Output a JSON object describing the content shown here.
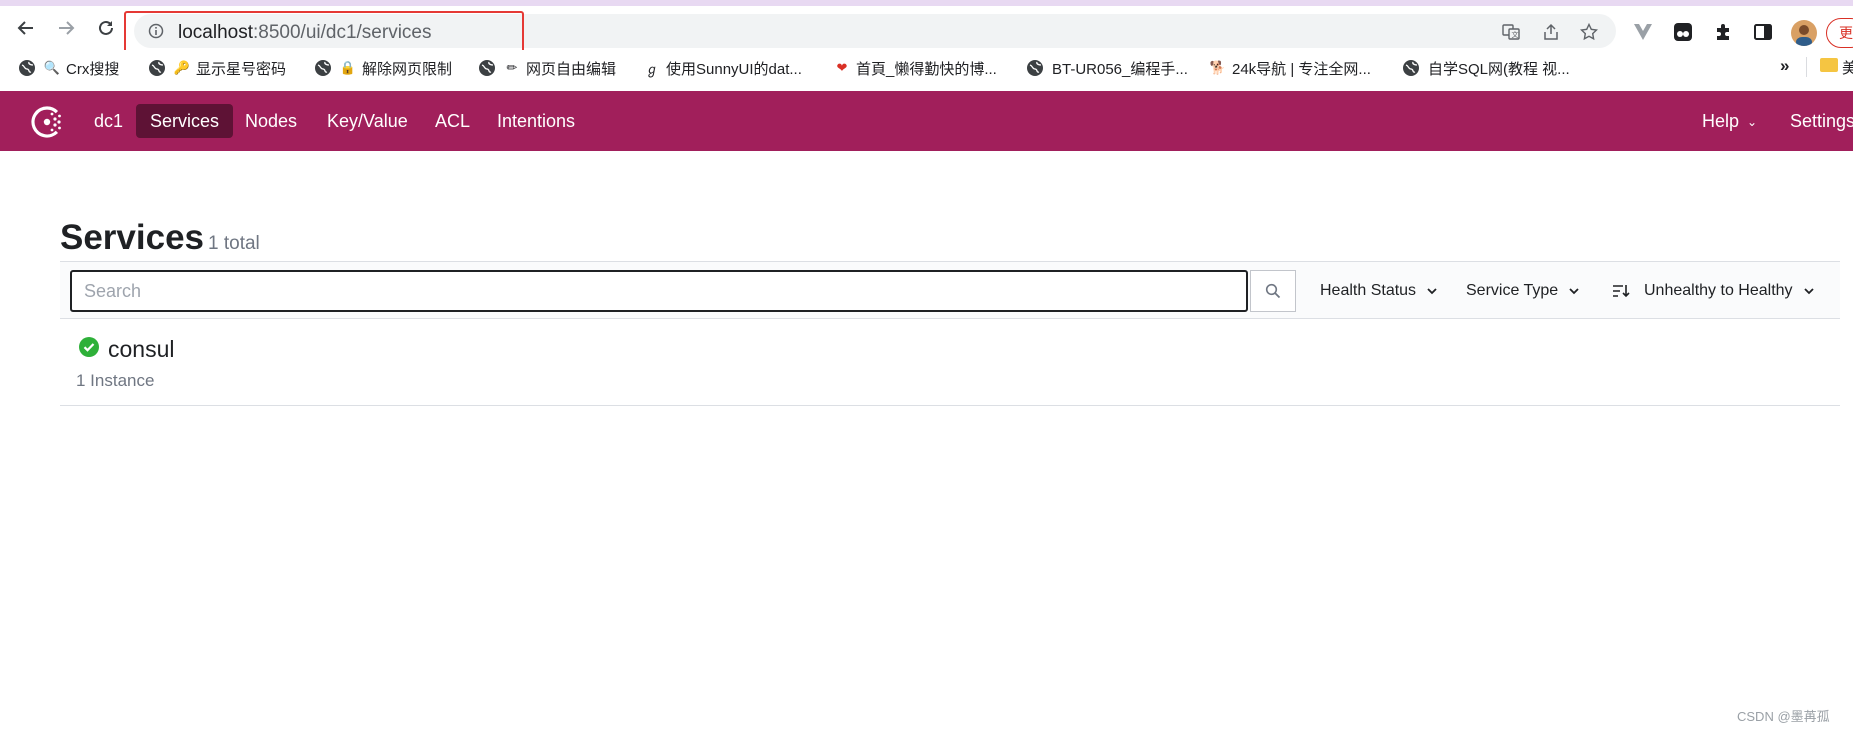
{
  "browser": {
    "url_host": "localhost",
    "url_rest": ":8500/ui/dc1/services",
    "bookmarks": [
      {
        "label": "Crx搜搜"
      },
      {
        "label": "显示星号密码"
      },
      {
        "label": "解除网页限制"
      },
      {
        "label": "网页自由编辑"
      },
      {
        "label": "使用SunnyUI的dat..."
      },
      {
        "label": "首頁_懒得勤快的博..."
      },
      {
        "label": "BT-UR056_编程手..."
      },
      {
        "label": "24k导航 | 专注全网..."
      },
      {
        "label": "自学SQL网(教程 视..."
      }
    ],
    "bookmarks_overflow": "»",
    "bookmark_cut": "美",
    "update_label": "更"
  },
  "app": {
    "datacenter": "dc1",
    "nav": [
      "Services",
      "Nodes",
      "Key/Value",
      "ACL",
      "Intentions"
    ],
    "help_label": "Help",
    "settings_label": "Settings"
  },
  "page": {
    "title": "Services",
    "count": "1 total",
    "search_placeholder": "Search",
    "filters": {
      "health_status": "Health Status",
      "service_type": "Service Type",
      "sort": "Unhealthy to Healthy"
    },
    "services": [
      {
        "name": "consul",
        "instances": "1 Instance",
        "status": "passing",
        "status_color": "#2eb039"
      }
    ]
  },
  "colors": {
    "brand": "#a11f5b",
    "brand_active": "#5e1235",
    "highlight": "#e53935"
  },
  "watermark": "CSDN @墨苒孤"
}
